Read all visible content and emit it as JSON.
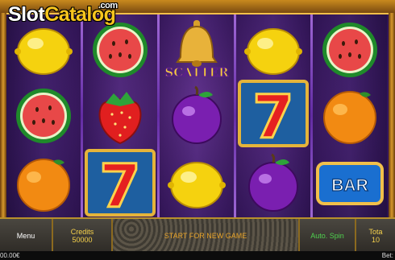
{
  "branding": {
    "logo_part1": "Slot",
    "logo_part2": "Catalog",
    "logo_suffix": ".com"
  },
  "reels": [
    [
      "lemon",
      "watermelon",
      "orange"
    ],
    [
      "watermelon",
      "strawberry",
      "seven"
    ],
    [
      "scatter",
      "plum",
      "lemon"
    ],
    [
      "lemon",
      "seven",
      "plum"
    ],
    [
      "watermelon",
      "orange",
      "bar"
    ]
  ],
  "symbols": {
    "scatter_label": "SCATTER",
    "bar_label": "BAR"
  },
  "controls": {
    "menu_label": "Menu",
    "credits_label": "Credits",
    "credits_value": "50000",
    "status_message": "START FOR NEW GAME",
    "autospin_label": "Auto. Spin",
    "total_label": "Tota",
    "total_value": "10"
  },
  "footer": {
    "balance": "00.00€",
    "bet_label": "Bet:"
  },
  "colors": {
    "accent_gold": "#f7c51e",
    "autospin_green": "#4fd14f",
    "status_orange": "#e5a128"
  }
}
